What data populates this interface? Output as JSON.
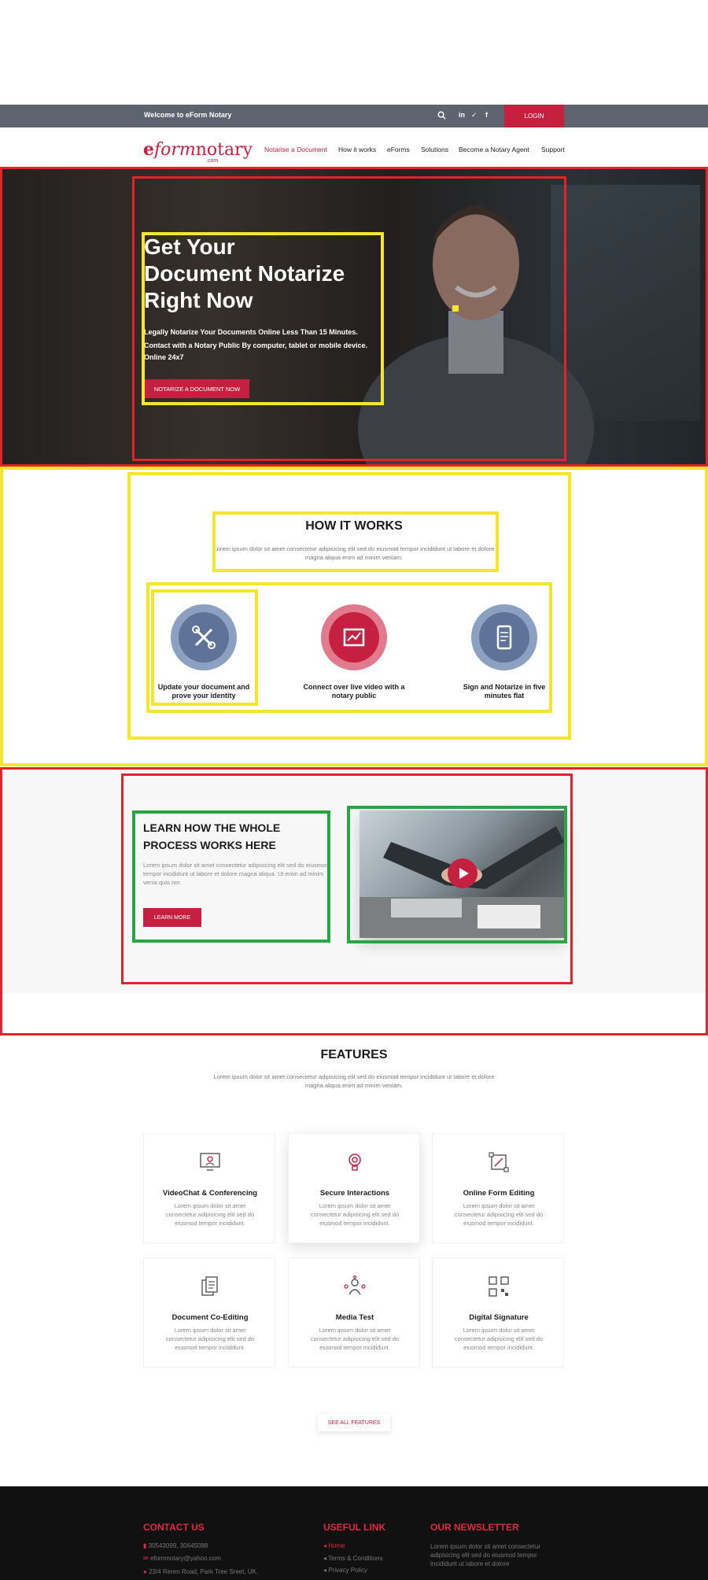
{
  "topbar": {
    "welcome": "Welcome to eForm Notary",
    "social": [
      "in",
      "✓",
      "f"
    ],
    "login": "LOGIN"
  },
  "logo": {
    "e": "e",
    "form": "form",
    "notary": "notary",
    "com": ".com"
  },
  "nav": {
    "items": [
      {
        "label": "Notarise a Document",
        "active": true
      },
      {
        "label": "How it works"
      },
      {
        "label": "eForms"
      },
      {
        "label": "Solutions"
      },
      {
        "label": "Become a Notary Agent"
      },
      {
        "label": "Support"
      }
    ]
  },
  "hero": {
    "title_line1": "Get Your",
    "title_line2": "Document Notarize",
    "title_line3": "Right Now",
    "sub1": "Legally Notarize Your Documents Online Less Than 15 Minutes.",
    "sub2": "Contact with a Notary Public By computer, tablet or mobile device. Online 24x7",
    "cta": "NOTARIZE A DOCUMENT NOW"
  },
  "how": {
    "title": "HOW IT WORKS",
    "sub": "Lorem ipsum dolor sit amet consectetur adipisicing elit sed do eiusmod tempor incididunt ut labore et dolore magna aliqua enim ad minim veniam.",
    "steps": [
      {
        "label": "Update your document and prove your identity",
        "icon": "tools-icon",
        "color": "#5f7399"
      },
      {
        "label": "Connect over live video with a notary public",
        "icon": "sign-board-icon",
        "color": "#c5203f"
      },
      {
        "label": "Sign and Notarize in five minutes flat",
        "icon": "mobile-doc-icon",
        "color": "#5f7399"
      }
    ]
  },
  "learn": {
    "title": "LEARN HOW THE WHOLE PROCESS WORKS HERE",
    "text": "Lorem ipsum dolor sit amet consectetur adipisicing elit sed do eiusmod tempor incididunt ut labore et dolore magna aliqua. Ut enim ad minim venia quis nor.",
    "button": "LEARN MORE"
  },
  "features": {
    "title": "FEATURES",
    "sub": "Lorem ipsum dolor sit amet consectetur adipisicing elit sed do eiusmod tempor incididunt ut labore et dolore magna aliqua enim ad minim veniam.",
    "cards": [
      {
        "title": "VideoChat & Conferencing",
        "desc": "Lorem ipsum dolor sit amet consectetur adipisicing elit sed do eiusmod tempor incididunt.",
        "icon": "video-chat-icon"
      },
      {
        "title": "Secure Interactions",
        "desc": "Lorem ipsum dolor sit amet consectetur adipisicing elit sed do eiusmod tempor incididunt.",
        "icon": "bulb-target-icon"
      },
      {
        "title": "Online Form Editing",
        "desc": "Lorem ipsum dolor sit amet consectetur adipisicing elit sed do eiusmod tempor incididunt.",
        "icon": "form-edit-icon"
      },
      {
        "title": "Document Co-Editing",
        "desc": "Lorem ipsum dolor sit amet consectetur adipisicing elit sed do eiusmod tempor incididunt.",
        "icon": "documents-icon"
      },
      {
        "title": "Media Test",
        "desc": "Lorem ipsum dolor sit amet consectetur adipisicing elit sed do eiusmod tempor incididunt.",
        "icon": "network-person-icon"
      },
      {
        "title": "Digital Signature",
        "desc": "Lorem ipsum dolor sit amet consectetur adipisicing elit sed do eiusmod tempor incididunt.",
        "icon": "qr-code-icon"
      }
    ],
    "see_all": "SEE ALL FEATURES"
  },
  "footer": {
    "contact_title": "CONTACT US",
    "phone": "30543099, 30645088",
    "email": "eformnotary@yahoo.com",
    "address": "23/4 Reren Road, Park Tree Sreet, UK.",
    "links_title": "USEFUL LINK",
    "links": [
      "Home",
      "Terms & Conditions",
      "Privacy Policy"
    ],
    "newsletter_title": "OUR NEWSLETTER",
    "newsletter_text": "Lorem ipsum dolor sit amet consectetur adipisicing elit sed do eiusmod tempor incididunt ut labore et dolore"
  },
  "colors": {
    "brand": "#c5203f",
    "topbar": "#5d6470",
    "footer": "#111111"
  }
}
